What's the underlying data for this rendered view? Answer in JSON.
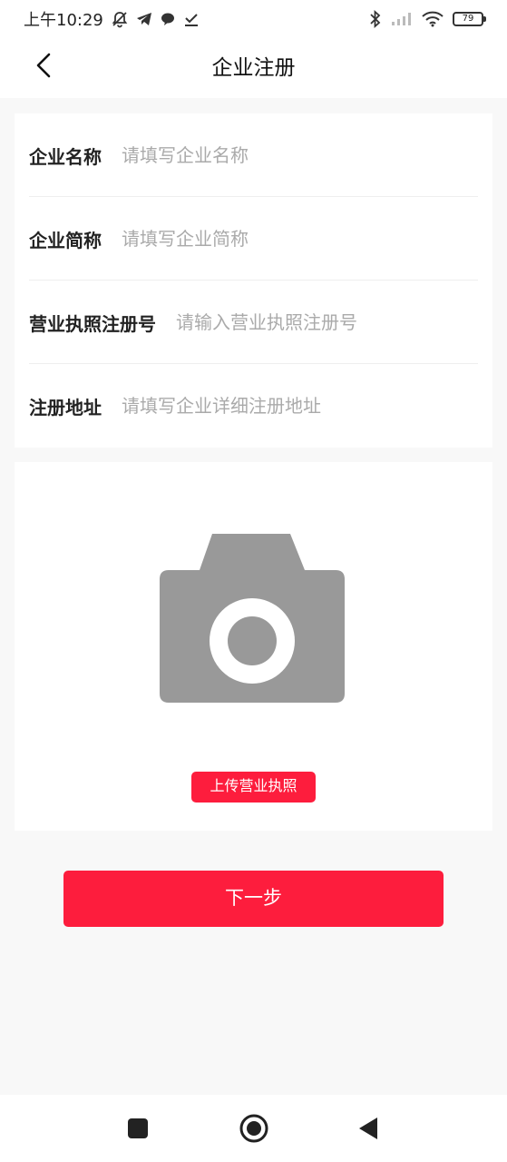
{
  "status_bar": {
    "time": "上午10:29",
    "battery": "79",
    "icons": [
      "bell-off-icon",
      "telegram-icon",
      "chat-bubble-icon",
      "download-check-icon",
      "bluetooth-icon",
      "signal-icon",
      "wifi-icon",
      "battery-icon"
    ]
  },
  "header": {
    "title": "企业注册",
    "back_icon": "chevron-left-icon"
  },
  "form": {
    "rows": [
      {
        "label": "企业名称",
        "placeholder": "请填写企业名称"
      },
      {
        "label": "企业简称",
        "placeholder": "请填写企业简称"
      },
      {
        "label": "营业执照注册号",
        "placeholder": "请输入营业执照注册号"
      },
      {
        "label": "注册地址",
        "placeholder": "请填写企业详细注册地址"
      }
    ]
  },
  "upload": {
    "icon": "camera-icon",
    "button_label": "上传营业执照"
  },
  "next_button": {
    "label": "下一步"
  },
  "colors": {
    "accent": "#fd1d3d",
    "background": "#f8f8f8",
    "card": "#ffffff",
    "placeholder": "#aaaaaa",
    "camera_gray": "#999999"
  },
  "bottom_nav": {
    "icons": [
      "square-icon",
      "circle-home-icon",
      "triangle-back-icon"
    ]
  }
}
